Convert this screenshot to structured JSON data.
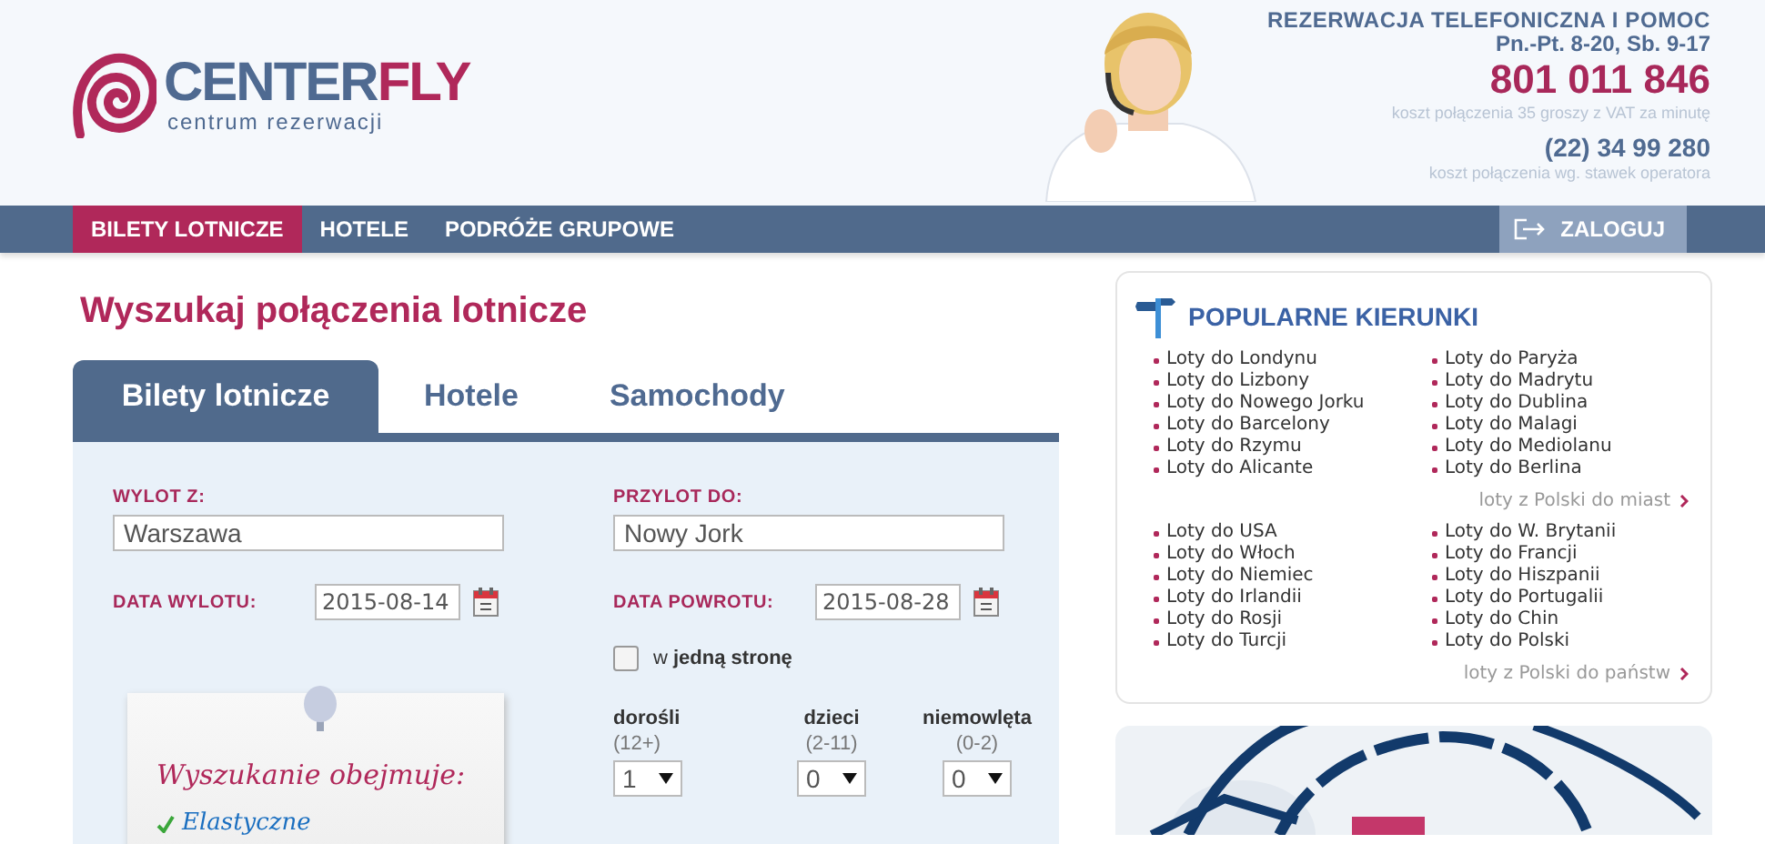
{
  "header": {
    "logo": {
      "brand_parts": [
        "CENTER",
        "FLY"
      ],
      "tagline": "centrum rezerwacji"
    },
    "contact": {
      "heading": "REZERWACJA TELEFONICZNA I POMOC",
      "hours": "Pn.-Pt. 8-20, Sb. 9-17",
      "phone": "801 011 846",
      "phone_note": "koszt połączenia 35 groszy z VAT za minutę",
      "phone2": "(22) 34 99 280",
      "phone2_note": "koszt połączenia wg. stawek operatora"
    }
  },
  "nav": {
    "items": [
      {
        "label": "BILETY LOTNICZE",
        "selected": true
      },
      {
        "label": "HOTELE",
        "selected": false
      },
      {
        "label": "PODRÓŻE GRUPOWE",
        "selected": false
      }
    ],
    "login": "ZALOGUJ"
  },
  "page_title": "Wyszukaj połączenia lotnicze",
  "search_tabs": [
    {
      "label": "Bilety lotnicze",
      "selected": true
    },
    {
      "label": "Hotele",
      "selected": false
    },
    {
      "label": "Samochody",
      "selected": false
    }
  ],
  "form": {
    "origin": {
      "label": "WYLOT Z:",
      "value": "Warszawa"
    },
    "destination": {
      "label": "PRZYLOT DO:",
      "value": "Nowy Jork"
    },
    "depart_date": {
      "label": "DATA WYLOTU:",
      "value": "2015-08-14"
    },
    "return_date": {
      "label": "DATA POWROTU:",
      "value": "2015-08-28"
    },
    "one_way": {
      "label": "w **jedną stronę**",
      "checked": false
    },
    "passengers": [
      {
        "label": "dorośli",
        "age": "(12+)",
        "value": "1"
      },
      {
        "label": "dzieci",
        "age": "(2-11)",
        "value": "0"
      },
      {
        "label": "niemowlęta",
        "age": "(0-2)",
        "value": "0"
      }
    ]
  },
  "note": {
    "title": "Wyszukanie obejmuje:",
    "items": [
      "Elastyczne"
    ]
  },
  "popular": {
    "title": "POPULARNE KIERUNKI",
    "groups": [
      {
        "columns": [
          [
            "Loty do Londynu",
            "Loty do Lizbony",
            "Loty do Nowego Jorku",
            "Loty do Barcelony",
            "Loty do Rzymu",
            "Loty do Alicante"
          ],
          [
            "Loty do Paryża",
            "Loty do Madrytu",
            "Loty do Dublina",
            "Loty do Malagi",
            "Loty do Mediolanu",
            "Loty do Berlina"
          ]
        ],
        "more": "loty z Polski do miast"
      },
      {
        "columns": [
          [
            "Loty do USA",
            "Loty do Włoch",
            "Loty do Niemiec",
            "Loty do Irlandii",
            "Loty do Rosji",
            "Loty do Turcji"
          ],
          [
            "Loty do W. Brytanii",
            "Loty do Francji",
            "Loty do Hiszpanii",
            "Loty do Portugalii",
            "Loty do Chin",
            "Loty do Polski"
          ]
        ],
        "more": "loty z Polski do państw"
      }
    ]
  }
}
